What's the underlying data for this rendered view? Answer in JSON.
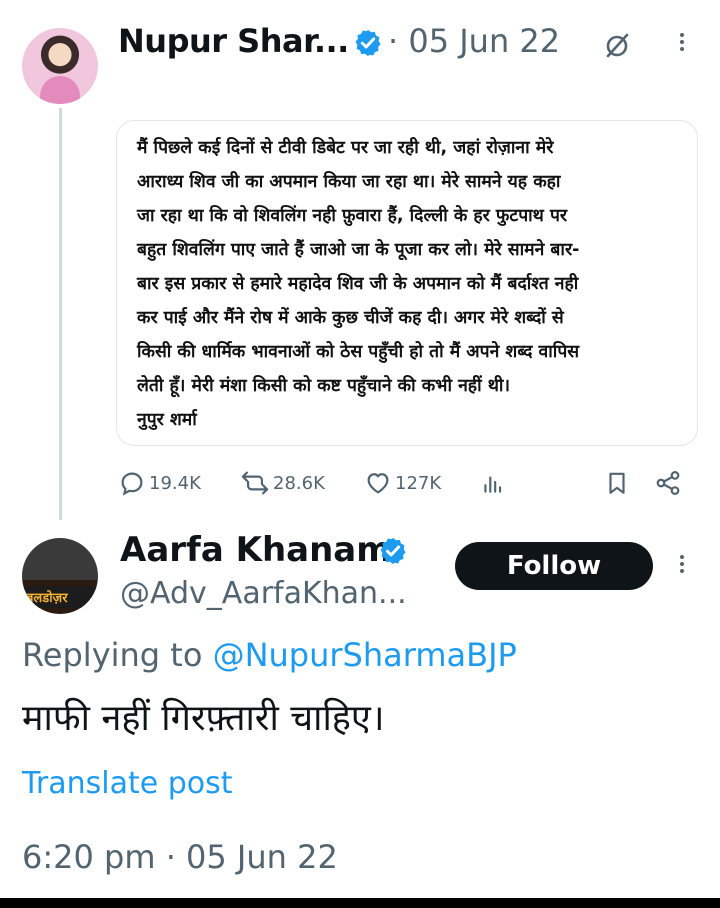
{
  "tweet1": {
    "name": "Nupur Shar...",
    "date": "· 05 Jun 22",
    "card_text": "मैं पिछले कई दिनों से टीवी डिबेट पर जा रही थी, जहां रोज़ाना मेरे\nआराध्य शिव जी का अपमान किया जा रहा था। मेरे सामने यह कहा\nजा रहा था कि वो शिवलिंग नही फ़ुवारा हैं, दिल्ली के हर फुटपाथ पर\nबहुत शिवलिंग पाए जाते हैं जाओ जा के पूजा कर लो। मेरे सामने बार-\nबार इस प्रकार से हमारे महादेव शिव जी के अपमान को मैं बर्दाश्त नही\nकर पाई और मैंने रोष में आके कुछ चीजें कह दी। अगर मेरे शब्दों से\nकिसी की धार्मिक भावनाओं को ठेस पहुँची हो तो मैं अपने शब्द वापिस\nलेती हूँ। मेरी मंशा किसी को कष्ट पहुँचाने की कभी नहीं थी।\nनुपुर शर्मा",
    "stats": {
      "replies": "19.4K",
      "reposts": "28.6K",
      "likes": "127K"
    }
  },
  "tweet2": {
    "name": "Aarfa Khanam",
    "handle": "@Adv_AarfaKhan...",
    "follow_label": "Follow",
    "avatar_text": "बलडोज़र",
    "replying_prefix": "Replying to ",
    "replying_mention": "@NupurSharmaBJP",
    "body": "माफी नहीं गिरफ़्तारी चाहिए।",
    "translate_label": "Translate post",
    "timestamp": "6:20 pm · 05 Jun 22"
  },
  "colors": {
    "verified": "#1d9bf0",
    "link": "#1d9bf0",
    "muted": "#536471",
    "text": "#0f1419"
  },
  "icons": [
    "verified-badge-icon",
    "edit-icon",
    "more-icon",
    "reply-icon",
    "repost-icon",
    "like-icon",
    "views-icon",
    "bookmark-icon",
    "share-icon"
  ]
}
